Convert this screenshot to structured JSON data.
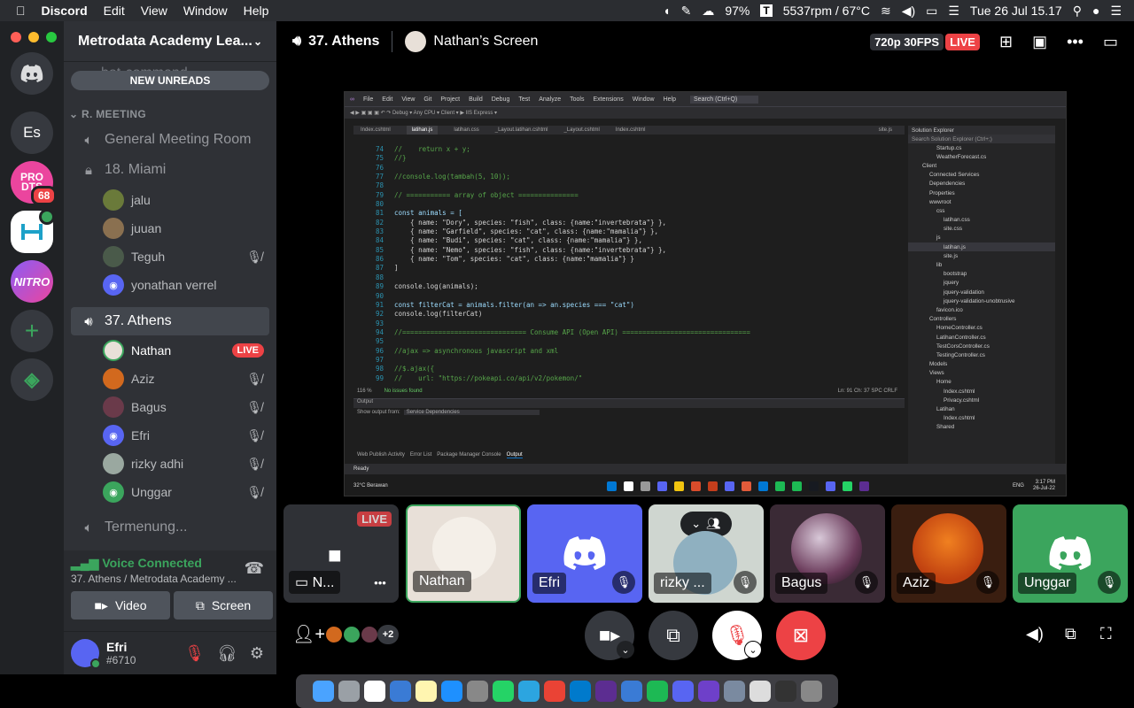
{
  "menubar": {
    "app": "Discord",
    "items": [
      "Edit",
      "View",
      "Window",
      "Help"
    ],
    "battery": "97%",
    "fan": "5537rpm / 67°C",
    "clock": "Tue 26 Jul  15.17"
  },
  "guilds": {
    "items": [
      {
        "label": "Es",
        "color": "#36393f"
      },
      {
        "label": "PRO DTS",
        "color": "#eb459e",
        "badge": "68"
      },
      {
        "label": "",
        "color": "#ffffff"
      },
      {
        "label": "NITRO",
        "color": "#b845c1"
      }
    ]
  },
  "sidebar": {
    "server": "Metrodata Academy Lea...",
    "faded_channel": "bot-command",
    "new_unreads": "NEW UNREADS",
    "category": "R. MEETING",
    "channels": {
      "general": "General Meeting Room",
      "miami": "18. Miami",
      "athens": "37. Athens",
      "termenung": "Termenung..."
    },
    "miami_users": [
      "jalu",
      "juuan",
      "Teguh",
      "yonathan verrel"
    ],
    "athens_users": [
      "Nathan",
      "Aziz",
      "Bagus",
      "Efri",
      "rizky adhi",
      "Unggar"
    ],
    "live": "LIVE"
  },
  "voice": {
    "status": "Voice Connected",
    "sub": "37. Athens / Metrodata Academy ...",
    "video": "Video",
    "screen": "Screen"
  },
  "user_panel": {
    "name": "Efri",
    "tag": "#6710"
  },
  "topbar": {
    "channel": "37. Athens",
    "screen": "Nathan’s Screen",
    "quality": "720p 30FPS",
    "live": "LIVE"
  },
  "stream": {
    "tabs": [
      "Index.cshtml",
      "latihan.js",
      "latihan.css",
      "_Layout.latihan.cshtml",
      "_Layout.cshtml",
      "Index.cshtml",
      "site.js"
    ],
    "menu": [
      "File",
      "Edit",
      "View",
      "Git",
      "Project",
      "Build",
      "Debug",
      "Test",
      "Analyze",
      "Tools",
      "Extensions",
      "Window",
      "Help"
    ],
    "search": "Search (Ctrl+Q)",
    "code": [
      {
        "n": "74",
        "t": "//    return x + y;"
      },
      {
        "n": "75",
        "t": "//}"
      },
      {
        "n": "76",
        "t": ""
      },
      {
        "n": "77",
        "t": "//console.log(tambah(5, 10));"
      },
      {
        "n": "78",
        "t": ""
      },
      {
        "n": "79",
        "t": "// =========== array of object ==============="
      },
      {
        "n": "80",
        "t": ""
      },
      {
        "n": "81",
        "t": "const animals = ["
      },
      {
        "n": "82",
        "t": "    { name: \"Dory\", species: \"fish\", class: {name:\"invertebrata\"} },"
      },
      {
        "n": "83",
        "t": "    { name: \"Garfield\", species: \"cat\", class: {name:\"mamalia\"} },"
      },
      {
        "n": "84",
        "t": "    { name: \"Budi\", species: \"cat\", class: {name:\"mamalia\"} },"
      },
      {
        "n": "85",
        "t": "    { name: \"Nemo\", species: \"fish\", class: {name:\"invertebrata\"} },"
      },
      {
        "n": "86",
        "t": "    { name: \"Tom\", species: \"cat\", class: {name:\"mamalia\"} }"
      },
      {
        "n": "87",
        "t": "]"
      },
      {
        "n": "88",
        "t": ""
      },
      {
        "n": "89",
        "t": "console.log(animals);"
      },
      {
        "n": "90",
        "t": ""
      },
      {
        "n": "91",
        "t": "const filterCat = animals.filter(an => an.species === \"cat\")"
      },
      {
        "n": "92",
        "t": "console.log(filterCat)"
      },
      {
        "n": "93",
        "t": ""
      },
      {
        "n": "94",
        "t": "//=============================== Consume API (Open API) ================================"
      },
      {
        "n": "95",
        "t": ""
      },
      {
        "n": "96",
        "t": "//ajax => asynchronous javascript and xml"
      },
      {
        "n": "97",
        "t": ""
      },
      {
        "n": "98",
        "t": "//$.ajax({"
      },
      {
        "n": "99",
        "t": "//    url: \"https://pokeapi.co/api/v2/pokemon/\""
      }
    ],
    "solution_title": "Solution Explorer",
    "solution_search": "Search Solution Explorer (Ctrl+;)",
    "solution": [
      "Startup.cs",
      "WeatherForecast.cs",
      "Client",
      "Connected Services",
      "Dependencies",
      "Properties",
      "wwwroot",
      "css",
      "latihan.css",
      "site.css",
      "js",
      "latihan.js",
      "site.js",
      "lib",
      "bootstrap",
      "jquery",
      "jquery-validation",
      "jquery-validation-unobtrusive",
      "favicon.ico",
      "Controllers",
      "HomeController.cs",
      "LatihanController.cs",
      "TestCorsController.cs",
      "TestingController.cs",
      "Models",
      "Views",
      "Home",
      "Index.cshtml",
      "Privacy.cshtml",
      "Latihan",
      "Index.cshtml",
      "Shared"
    ],
    "output_label": "Output",
    "output_from": "Show output from:",
    "output_value": "Service Dependencies",
    "bottom_tabs": [
      "Web Publish Activity",
      "Error List",
      "Package Manager Console",
      "Output"
    ],
    "status": "Ready",
    "zoom": "116 %",
    "issues": "No issues found",
    "cursor": "Ln: 91   Ch: 37   SPC   CRLF",
    "weather": "32°C Berawan",
    "lang": "ENG",
    "time": "3:17 PM",
    "date": "26-Jul-22"
  },
  "tiles": [
    {
      "name": "N...",
      "live": "LIVE",
      "color": "#2f3136"
    },
    {
      "name": "Nathan",
      "color": "#e8e0d8"
    },
    {
      "name": "Efri",
      "color": "#5865f2"
    },
    {
      "name": "rizky ...",
      "color": "#cfd6d0"
    },
    {
      "name": "Bagus",
      "color": "#3a2a35"
    },
    {
      "name": "Aziz",
      "color": "#3a1e10"
    },
    {
      "name": "Unggar",
      "color": "#3ba55d"
    }
  ],
  "participants_more": "+2",
  "colors": {
    "accent": "#5865f2",
    "green": "#3ba55d",
    "red": "#ed4245"
  }
}
